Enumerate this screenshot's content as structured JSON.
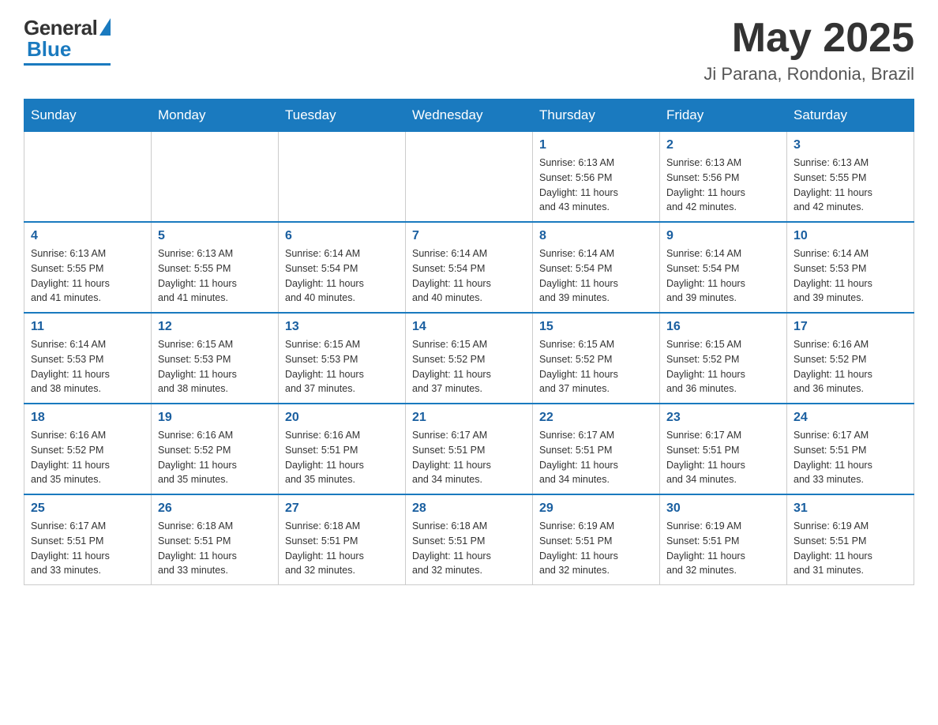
{
  "header": {
    "logo_general": "General",
    "logo_blue": "Blue",
    "month_title": "May 2025",
    "location": "Ji Parana, Rondonia, Brazil"
  },
  "days_of_week": [
    "Sunday",
    "Monday",
    "Tuesday",
    "Wednesday",
    "Thursday",
    "Friday",
    "Saturday"
  ],
  "weeks": [
    [
      {
        "day": "",
        "info": ""
      },
      {
        "day": "",
        "info": ""
      },
      {
        "day": "",
        "info": ""
      },
      {
        "day": "",
        "info": ""
      },
      {
        "day": "1",
        "info": "Sunrise: 6:13 AM\nSunset: 5:56 PM\nDaylight: 11 hours\nand 43 minutes."
      },
      {
        "day": "2",
        "info": "Sunrise: 6:13 AM\nSunset: 5:56 PM\nDaylight: 11 hours\nand 42 minutes."
      },
      {
        "day": "3",
        "info": "Sunrise: 6:13 AM\nSunset: 5:55 PM\nDaylight: 11 hours\nand 42 minutes."
      }
    ],
    [
      {
        "day": "4",
        "info": "Sunrise: 6:13 AM\nSunset: 5:55 PM\nDaylight: 11 hours\nand 41 minutes."
      },
      {
        "day": "5",
        "info": "Sunrise: 6:13 AM\nSunset: 5:55 PM\nDaylight: 11 hours\nand 41 minutes."
      },
      {
        "day": "6",
        "info": "Sunrise: 6:14 AM\nSunset: 5:54 PM\nDaylight: 11 hours\nand 40 minutes."
      },
      {
        "day": "7",
        "info": "Sunrise: 6:14 AM\nSunset: 5:54 PM\nDaylight: 11 hours\nand 40 minutes."
      },
      {
        "day": "8",
        "info": "Sunrise: 6:14 AM\nSunset: 5:54 PM\nDaylight: 11 hours\nand 39 minutes."
      },
      {
        "day": "9",
        "info": "Sunrise: 6:14 AM\nSunset: 5:54 PM\nDaylight: 11 hours\nand 39 minutes."
      },
      {
        "day": "10",
        "info": "Sunrise: 6:14 AM\nSunset: 5:53 PM\nDaylight: 11 hours\nand 39 minutes."
      }
    ],
    [
      {
        "day": "11",
        "info": "Sunrise: 6:14 AM\nSunset: 5:53 PM\nDaylight: 11 hours\nand 38 minutes."
      },
      {
        "day": "12",
        "info": "Sunrise: 6:15 AM\nSunset: 5:53 PM\nDaylight: 11 hours\nand 38 minutes."
      },
      {
        "day": "13",
        "info": "Sunrise: 6:15 AM\nSunset: 5:53 PM\nDaylight: 11 hours\nand 37 minutes."
      },
      {
        "day": "14",
        "info": "Sunrise: 6:15 AM\nSunset: 5:52 PM\nDaylight: 11 hours\nand 37 minutes."
      },
      {
        "day": "15",
        "info": "Sunrise: 6:15 AM\nSunset: 5:52 PM\nDaylight: 11 hours\nand 37 minutes."
      },
      {
        "day": "16",
        "info": "Sunrise: 6:15 AM\nSunset: 5:52 PM\nDaylight: 11 hours\nand 36 minutes."
      },
      {
        "day": "17",
        "info": "Sunrise: 6:16 AM\nSunset: 5:52 PM\nDaylight: 11 hours\nand 36 minutes."
      }
    ],
    [
      {
        "day": "18",
        "info": "Sunrise: 6:16 AM\nSunset: 5:52 PM\nDaylight: 11 hours\nand 35 minutes."
      },
      {
        "day": "19",
        "info": "Sunrise: 6:16 AM\nSunset: 5:52 PM\nDaylight: 11 hours\nand 35 minutes."
      },
      {
        "day": "20",
        "info": "Sunrise: 6:16 AM\nSunset: 5:51 PM\nDaylight: 11 hours\nand 35 minutes."
      },
      {
        "day": "21",
        "info": "Sunrise: 6:17 AM\nSunset: 5:51 PM\nDaylight: 11 hours\nand 34 minutes."
      },
      {
        "day": "22",
        "info": "Sunrise: 6:17 AM\nSunset: 5:51 PM\nDaylight: 11 hours\nand 34 minutes."
      },
      {
        "day": "23",
        "info": "Sunrise: 6:17 AM\nSunset: 5:51 PM\nDaylight: 11 hours\nand 34 minutes."
      },
      {
        "day": "24",
        "info": "Sunrise: 6:17 AM\nSunset: 5:51 PM\nDaylight: 11 hours\nand 33 minutes."
      }
    ],
    [
      {
        "day": "25",
        "info": "Sunrise: 6:17 AM\nSunset: 5:51 PM\nDaylight: 11 hours\nand 33 minutes."
      },
      {
        "day": "26",
        "info": "Sunrise: 6:18 AM\nSunset: 5:51 PM\nDaylight: 11 hours\nand 33 minutes."
      },
      {
        "day": "27",
        "info": "Sunrise: 6:18 AM\nSunset: 5:51 PM\nDaylight: 11 hours\nand 32 minutes."
      },
      {
        "day": "28",
        "info": "Sunrise: 6:18 AM\nSunset: 5:51 PM\nDaylight: 11 hours\nand 32 minutes."
      },
      {
        "day": "29",
        "info": "Sunrise: 6:19 AM\nSunset: 5:51 PM\nDaylight: 11 hours\nand 32 minutes."
      },
      {
        "day": "30",
        "info": "Sunrise: 6:19 AM\nSunset: 5:51 PM\nDaylight: 11 hours\nand 32 minutes."
      },
      {
        "day": "31",
        "info": "Sunrise: 6:19 AM\nSunset: 5:51 PM\nDaylight: 11 hours\nand 31 minutes."
      }
    ]
  ]
}
